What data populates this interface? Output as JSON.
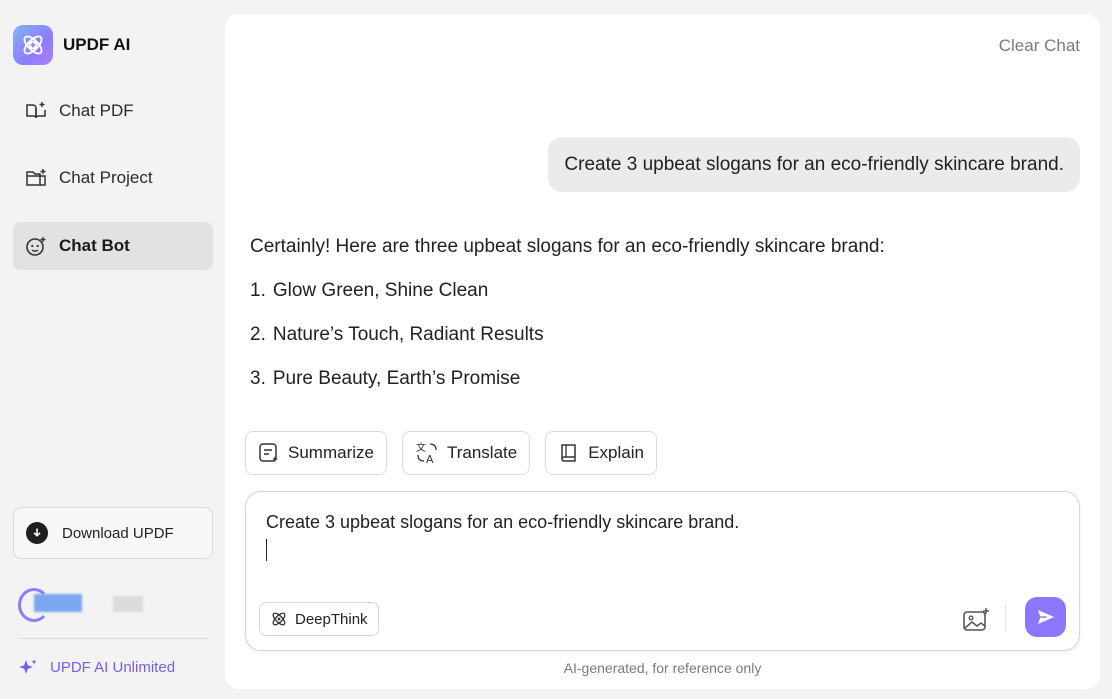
{
  "brand": {
    "name": "UPDF AI"
  },
  "sidebar": {
    "items": [
      {
        "label": "Chat PDF",
        "icon": "book-sparkle-icon"
      },
      {
        "label": "Chat Project",
        "icon": "folder-sparkle-icon"
      },
      {
        "label": "Chat Bot",
        "icon": "bot-face-icon",
        "active": true
      }
    ],
    "download_label": "Download UPDF",
    "unlimited_label": "UPDF AI Unlimited"
  },
  "header": {
    "clear_chat": "Clear Chat"
  },
  "conversation": {
    "user_message": "Create 3 upbeat slogans for an eco-friendly skincare brand.",
    "assistant_intro": "Certainly! Here are three upbeat slogans for an eco-friendly skincare brand:",
    "assistant_items": [
      {
        "num": "1.",
        "text": "Glow Green, Shine Clean"
      },
      {
        "num": "2.",
        "text": "Nature’s Touch, Radiant Results"
      },
      {
        "num": "3.",
        "text": "Pure Beauty, Earth’s Promise"
      }
    ]
  },
  "actions": {
    "summarize": "Summarize",
    "translate": "Translate",
    "explain": "Explain"
  },
  "composer": {
    "value": "Create 3 upbeat slogans for an eco-friendly skincare brand.",
    "deepthink_label": "DeepThink"
  },
  "footer": {
    "note": "AI-generated, for reference only"
  },
  "colors": {
    "accent": "#8c78ff",
    "unlimited": "#7a5cf0"
  }
}
